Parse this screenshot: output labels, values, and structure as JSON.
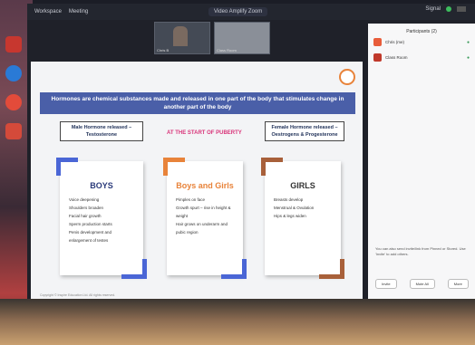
{
  "topbar": {
    "app_name": "Workspace",
    "tab_meeting": "Meeting",
    "center_label": "Video Amplify Zoom",
    "right_label": "Signal"
  },
  "videos": [
    {
      "name": "Chris B"
    },
    {
      "name": "Class Room"
    }
  ],
  "slide": {
    "banner": "Hormones are chemical substances made and released in one part of the body that stimulates change in another part of the body",
    "male_box": "Male Hormone released – Testosterone",
    "female_box": "Female Hormone released – Oestrogens & Progesterone",
    "puberty_label": "AT THE START OF PUBERTY",
    "cards": {
      "boys": {
        "title": "BOYS",
        "items": [
          "Voice deepening",
          "Shoulders broaden",
          "Facial hair growth",
          "Sperm production starts",
          "Penis development and enlargement of testes"
        ]
      },
      "both": {
        "title": "Boys and Girls",
        "items": [
          "Pimples on face",
          "Growth spurt – rise in height & weight",
          "Hair grows on underarm and pubic region"
        ]
      },
      "girls": {
        "title": "GIRLS",
        "items": [
          "Breasts develop",
          "Menstrual & Ovulation",
          "Hips & legs widen"
        ]
      }
    },
    "footer": "Copyright © Inspire Education Ltd. All rights reserved."
  },
  "panel": {
    "title": "Participants (2)",
    "participants": [
      {
        "name": "Chris (me)",
        "color": "#e85c3a"
      },
      {
        "name": "Class Room",
        "color": "#c0392b"
      }
    ],
    "message": "You can also send invite/link from Pinned or Stored. Use 'Invite' to add others.",
    "buttons": [
      "Invite",
      "Mute All",
      "More"
    ]
  },
  "colors": {
    "banner": "#4a5fa8",
    "accent_blue": "#4a66d6",
    "accent_orange": "#e8833a",
    "accent_brown": "#a8603a",
    "puberty": "#d9357a"
  }
}
